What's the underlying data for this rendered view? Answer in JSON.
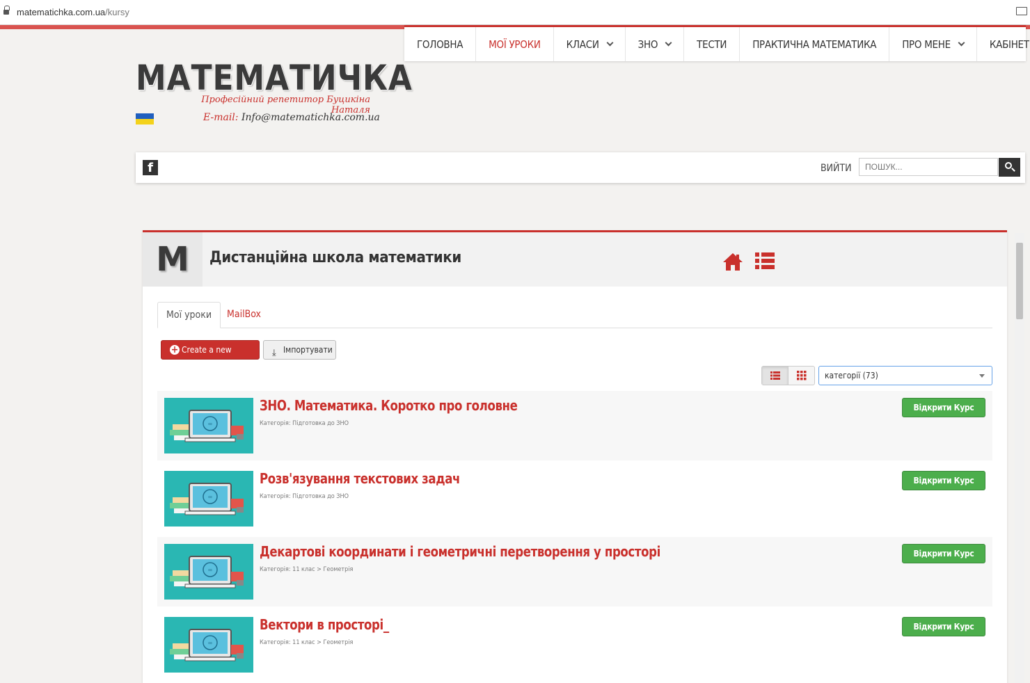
{
  "browser": {
    "url_host": "matematichka.com.ua",
    "url_path": "/kursy"
  },
  "nav": {
    "items": [
      {
        "label": "ГОЛОВНА",
        "active": false,
        "dropdown": false
      },
      {
        "label": "МОЇ УРОКИ",
        "active": true,
        "dropdown": false
      },
      {
        "label": "КЛАСИ",
        "active": false,
        "dropdown": true
      },
      {
        "label": "ЗНО",
        "active": false,
        "dropdown": true
      },
      {
        "label": "ТЕСТИ",
        "active": false,
        "dropdown": false
      },
      {
        "label": "ПРАКТИЧНА МАТЕМАТИКА",
        "active": false,
        "dropdown": false
      },
      {
        "label": "ПРО МЕНЕ",
        "active": false,
        "dropdown": true
      },
      {
        "label": "КАБІНЕТ",
        "active": false,
        "dropdown": true
      }
    ]
  },
  "site": {
    "logo": "МАТЕМАТИЧКА",
    "tagline": "Професійний репетитор Буцикіна Наталя",
    "email_label": "E-mail:",
    "email": "Info@matematichka.com.ua"
  },
  "toolbar": {
    "logout": "ВИЙТИ",
    "search_placeholder": "ПОШУК..."
  },
  "panel": {
    "logo_letter": "M",
    "title": "Дистанційна школа математики",
    "tabs": [
      "Мої уроки",
      "MailBox"
    ],
    "create_button": "Create a new course",
    "import_button": "Імпортувати",
    "category_select": "категорії (73)"
  },
  "courses": [
    {
      "title": "ЗНО. Математика. Коротко про головне",
      "category": "Категорія: Підготовка до ЗНО",
      "button": "Відкрити Курс"
    },
    {
      "title": "Розв'язування текстових задач",
      "category": "Категорія: Підготовка до ЗНО",
      "button": "Відкрити Курс"
    },
    {
      "title": "Декартові координати і геометричні перетворення у просторі",
      "category": "Категорія: 11 клас > Геометрія",
      "button": "Відкрити Курс"
    },
    {
      "title": "Вектори в просторі_",
      "category": "Категорія: 11 клас > Геометрія",
      "button": "Відкрити Курс"
    }
  ],
  "colors": {
    "accent": "#c9302c",
    "success": "#4cae4c",
    "thumb": "#2ab7b3"
  }
}
